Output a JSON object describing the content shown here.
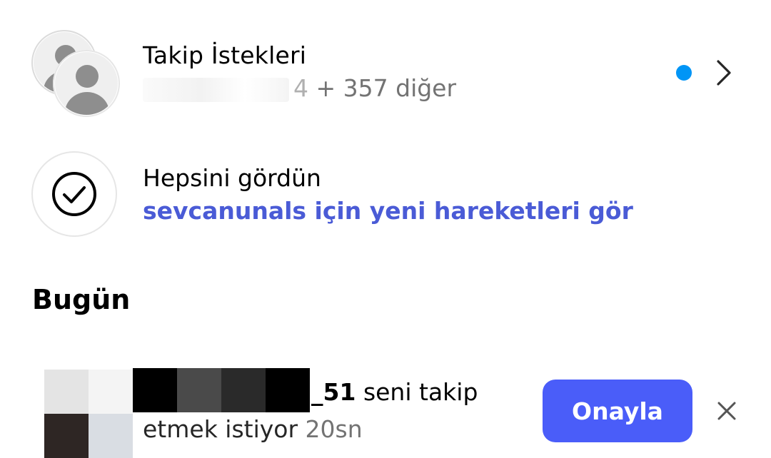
{
  "follow_requests": {
    "title": "Takip İstekleri",
    "visible_fragment": "4",
    "others": "+ 357 diğer",
    "unread_dot_color": "#0095f6",
    "avatar_icon": "default-avatar-icon",
    "chevron_icon": "chevron-right-icon"
  },
  "caught_up": {
    "title": "Hepsini gördün",
    "link": "sevcanunals için yeni hareketleri gör",
    "link_color": "#4a5bd6",
    "icon": "check-circle-icon"
  },
  "sections": {
    "today": "Bugün"
  },
  "notification": {
    "username_suffix": "_51",
    "action_text": "seni takip",
    "action_text_cont": "etmek istiyor",
    "time": "20sn",
    "approve_label": "Onayla",
    "approve_color": "#4a5df9",
    "dismiss_icon": "close-icon"
  }
}
